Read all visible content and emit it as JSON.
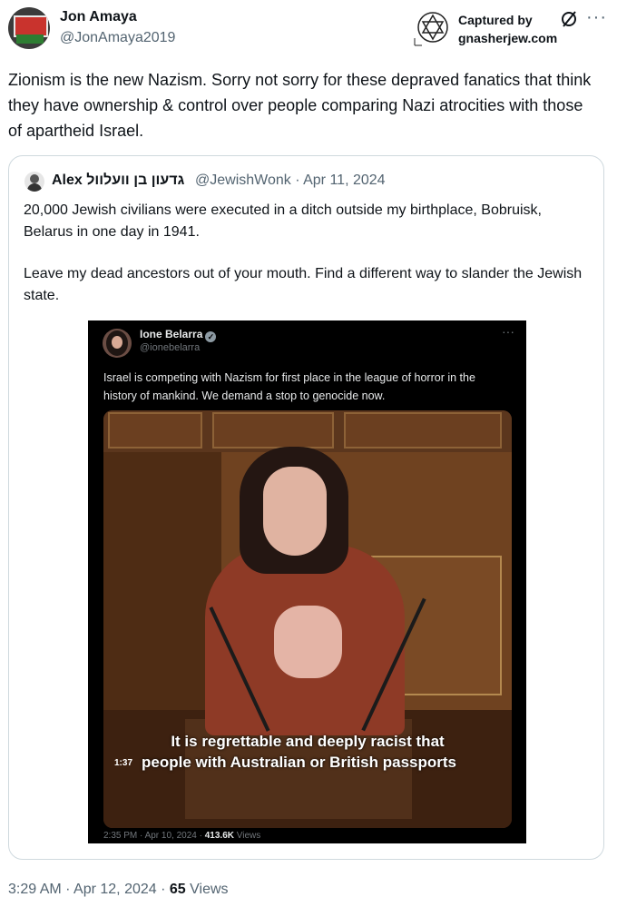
{
  "tweet": {
    "author_name": "Jon Amaya",
    "author_handle": "@JonAmaya2019",
    "text": "Zionism is the new Nazism. Sorry not sorry for these depraved fanatics that think they have ownership & control over people comparing Nazi atrocities with those of apartheid Israel.",
    "timestamp": "3:29 AM · Apr 12, 2024 · ",
    "views_count": "65",
    "views_label": " Views"
  },
  "watermark": {
    "line1": "Captured by",
    "line2": "gnasherjew.com"
  },
  "quote": {
    "author_name": "Alex גדעון בן וועלוול",
    "author_handle": "@JewishWonk",
    "date": "· Apr 11, 2024",
    "paragraph1": "20,000 Jewish civilians were executed in a ditch outside my birthplace, Bobruisk, Belarus in one day in 1941.",
    "paragraph2": "Leave my dead ancestors out of your mouth. Find a different way to slander the Jewish state."
  },
  "embedded": {
    "author_name": "Ione Belarra",
    "author_handle": "@ionebelarra",
    "text": "Israel is competing with Nazism for first place in the league of horror in the history of mankind. We demand a stop to genocide now.",
    "video_caption_line1": "It is regrettable and deeply racist that",
    "video_caption_line2": "people with Australian or British passports",
    "video_duration": "1:37",
    "footer_time": "2:35 PM · Apr 10, 2024 · ",
    "footer_views": "413.6K",
    "footer_views_label": " Views"
  },
  "icons": {
    "more": "more-icon",
    "captured_logo": "star-of-david-logo",
    "no_symbol": "no-symbol-icon",
    "verified": "verified-badge-icon"
  }
}
